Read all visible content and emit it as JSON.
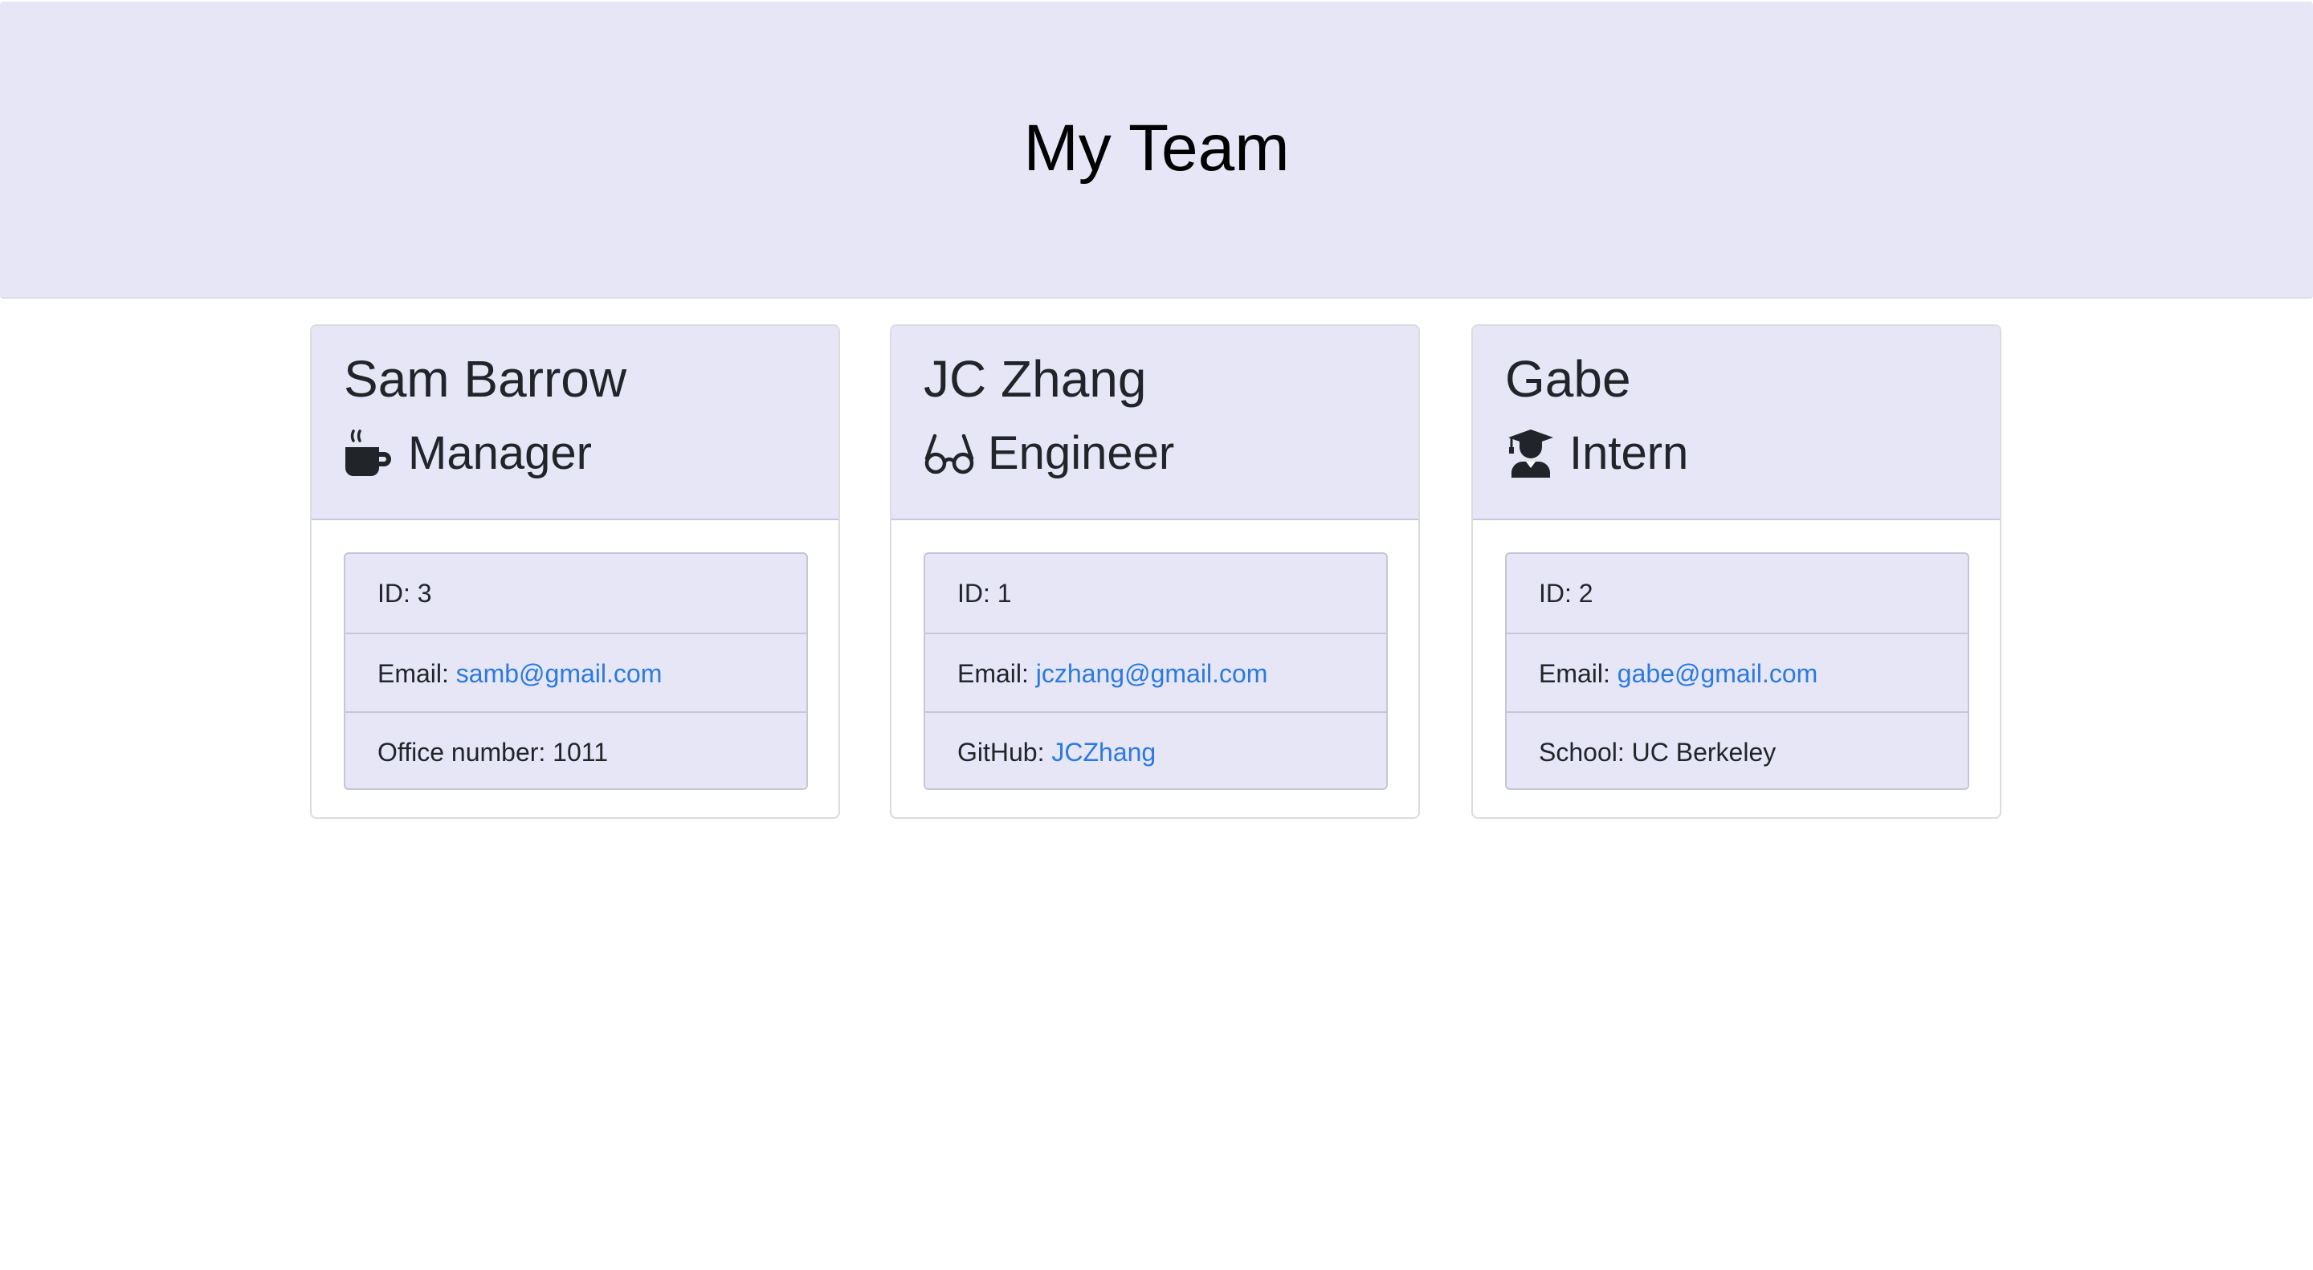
{
  "header": {
    "title": "My Team"
  },
  "colors": {
    "header_bg": "#e6e6f7",
    "link": "#2a7ae2",
    "text": "#212529"
  },
  "employees": [
    {
      "name": "Sam Barrow",
      "role": "Manager",
      "role_icon": "coffee-mug-icon",
      "id_label": "ID:",
      "id": "3",
      "email_label": "Email:",
      "email": "samb@gmail.com",
      "extra_label": "Office number:",
      "extra_value": "1011"
    },
    {
      "name": "JC Zhang",
      "role": "Engineer",
      "role_icon": "glasses-icon",
      "id_label": "ID:",
      "id": "1",
      "email_label": "Email:",
      "email": "jczhang@gmail.com",
      "extra_label": "GitHub:",
      "extra_value": "JCZhang"
    },
    {
      "name": "Gabe",
      "role": "Intern",
      "role_icon": "graduate-icon",
      "id_label": "ID:",
      "id": "2",
      "email_label": "Email:",
      "email": "gabe@gmail.com",
      "extra_label": "School:",
      "extra_value": "UC Berkeley"
    }
  ]
}
